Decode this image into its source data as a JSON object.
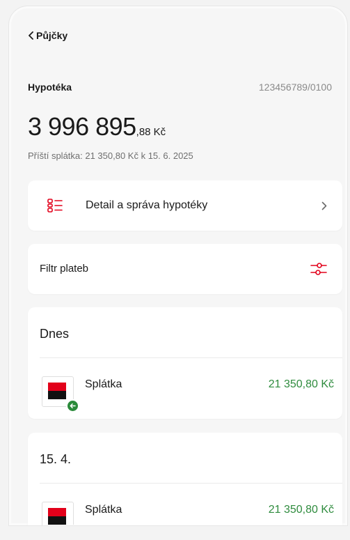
{
  "header": {
    "back_label": "Půjčky"
  },
  "account": {
    "name": "Hypotéka",
    "number": "123456789/0100",
    "balance_main": "3 996 895",
    "balance_decimal": ",88 Kč",
    "next_payment": "Příští splátka: 21 350,80 Kč k 15. 6. 2025"
  },
  "detail": {
    "label": "Detail a správa hypotéky",
    "icon": "list-icon"
  },
  "filter": {
    "label": "Filtr plateb",
    "icon": "sliders-icon"
  },
  "colors": {
    "accent_red": "#e2001a",
    "amount_green": "#2e8b3d"
  },
  "groups": [
    {
      "date": "Dnes",
      "transactions": [
        {
          "name": "Splátka",
          "amount": "21 350,80 Kč"
        }
      ]
    },
    {
      "date": "15. 4.",
      "transactions": [
        {
          "name": "Splátka",
          "amount": "21 350,80 Kč"
        }
      ]
    }
  ]
}
